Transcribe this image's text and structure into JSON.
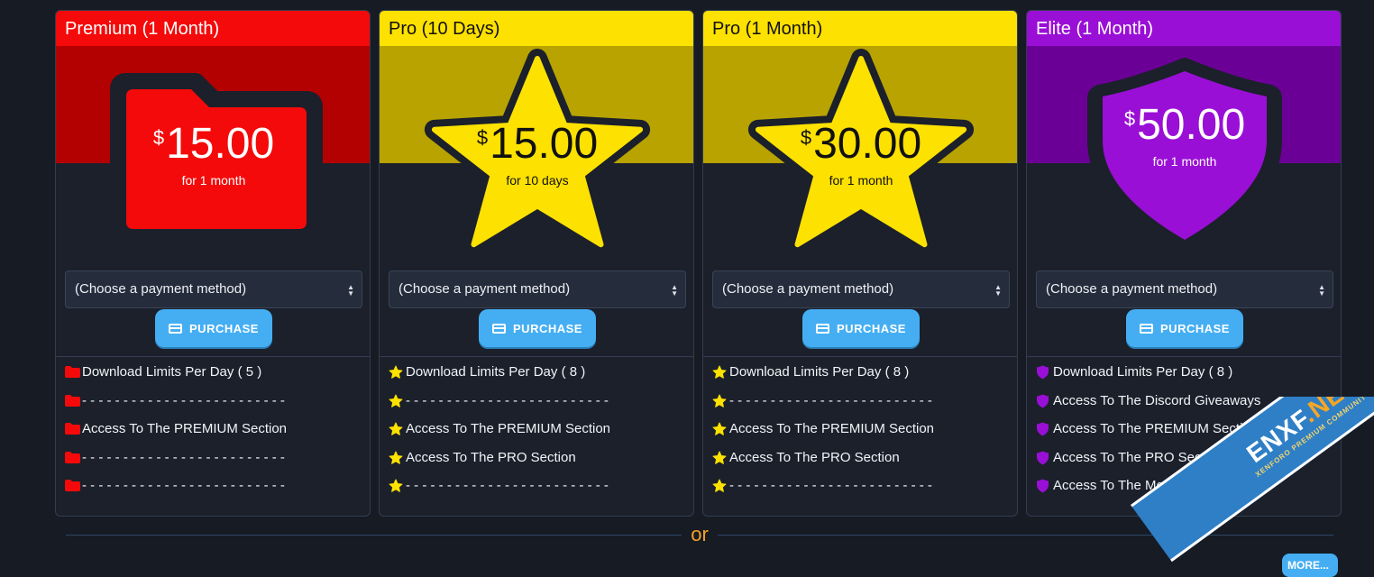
{
  "plans": [
    {
      "title": "Premium (1 Month)",
      "price": "15.00",
      "currency": "$",
      "period": "for 1 month",
      "icon": "folder-icon",
      "colors": {
        "title_bg": "#f40a0a",
        "banner": "#b30000",
        "badge": "#f40a0a",
        "text": "#ffffff"
      },
      "payment_placeholder": "(Choose a payment method)",
      "purchase_label": "PURCHASE",
      "features": [
        "Download Limits Per Day ( 5 )",
        "- - - - - - - - - - - - - - - - - - - - - - - - -",
        "Access To The PREMIUM Section",
        "- - - - - - - - - - - - - - - - - - - - - - - - -",
        "- - - - - - - - - - - - - - - - - - - - - - - - -"
      ]
    },
    {
      "title": "Pro (10 Days)",
      "price": "15.00",
      "currency": "$",
      "period": "for 10 days",
      "icon": "star-icon",
      "colors": {
        "title_bg": "#fde100",
        "banner": "#b8a300",
        "badge": "#fde100",
        "text": "#111111"
      },
      "payment_placeholder": "(Choose a payment method)",
      "purchase_label": "PURCHASE",
      "features": [
        "Download Limits Per Day ( 8 )",
        "- - - - - - - - - - - - - - - - - - - - - - - - -",
        "Access To The PREMIUM Section",
        "Access To The PRO Section",
        "- - - - - - - - - - - - - - - - - - - - - - - - -"
      ]
    },
    {
      "title": "Pro (1 Month)",
      "price": "30.00",
      "currency": "$",
      "period": "for 1 month",
      "icon": "star-icon",
      "colors": {
        "title_bg": "#fde100",
        "banner": "#b8a300",
        "badge": "#fde100",
        "text": "#111111"
      },
      "payment_placeholder": "(Choose a payment method)",
      "purchase_label": "PURCHASE",
      "features": [
        "Download Limits Per Day ( 8 )",
        "- - - - - - - - - - - - - - - - - - - - - - - - -",
        "Access To The PREMIUM Section",
        "Access To The PRO Section",
        "- - - - - - - - - - - - - - - - - - - - - - - - -"
      ]
    },
    {
      "title": "Elite (1 Month)",
      "price": "50.00",
      "currency": "$",
      "period": "for 1 month",
      "icon": "shield-icon",
      "colors": {
        "title_bg": "#9a0fd6",
        "banner": "#6b0096",
        "badge": "#9a0fd6",
        "text": "#ffffff"
      },
      "payment_placeholder": "(Choose a payment method)",
      "purchase_label": "PURCHASE",
      "features": [
        "Download Limits Per Day ( 8 )",
        "Access To The Discord Giveaways",
        "Access To The PREMIUM Section",
        "Access To The PRO Section",
        "Access To The Monthly VIP Assets"
      ]
    }
  ],
  "separator_text": "or",
  "more_label": "MORE...",
  "watermark": {
    "main_a": "ENXF",
    "main_b": ".NET",
    "sub": "XENFORO PREMIUM COMMUNITY"
  }
}
